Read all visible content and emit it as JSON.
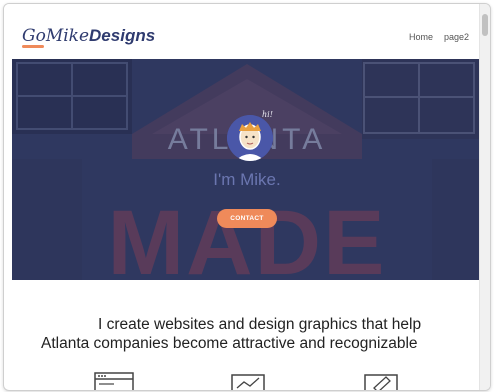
{
  "header": {
    "logo_part1": "GoMike",
    "logo_part2": "Designs",
    "nav": [
      {
        "label": "Home"
      },
      {
        "label": "page2"
      }
    ]
  },
  "hero": {
    "greeting": "hi!",
    "title": "I'm Mike.",
    "cta_label": "CONTACT",
    "background_words": [
      "ATLANTA",
      "MADE"
    ]
  },
  "intro": {
    "line1": "I create websites and design graphics that help",
    "line2": "Atlanta companies become attractive and recognizable"
  },
  "services": [
    {
      "icon": "browser-window-icon"
    },
    {
      "icon": "chart-icon"
    },
    {
      "icon": "pencil-icon"
    }
  ],
  "colors": {
    "brand_navy": "#2f3b6f",
    "accent_orange": "#ef8a5a",
    "hero_overlay": "#323c6e"
  }
}
